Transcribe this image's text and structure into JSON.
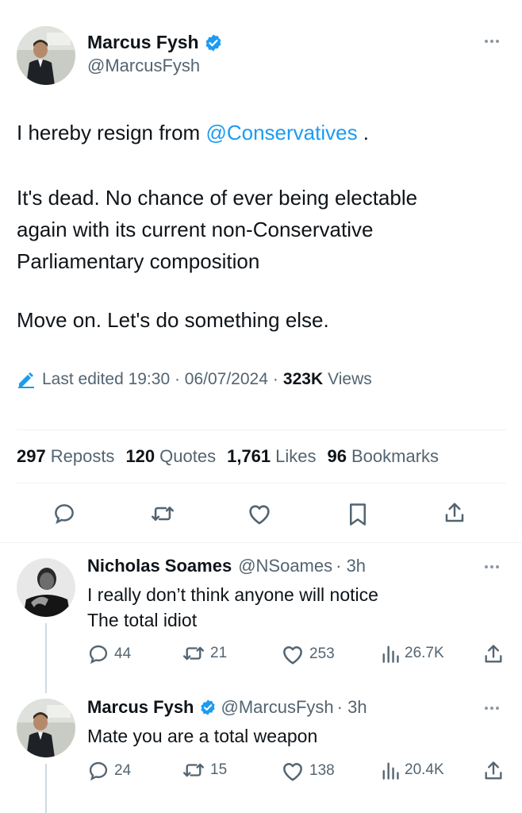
{
  "main_tweet": {
    "author_name": "Marcus Fysh",
    "handle": "@MarcusFysh",
    "text_line1_prefix": "I hereby resign from ",
    "mention": "@Conservatives",
    "text_line1_suffix": " .",
    "para2_line1": "It's dead. No chance of ever being electable",
    "para2_line2": "again with its current non-Conservative",
    "para2_line3": "Parliamentary composition",
    "para3": "Move on. Let's do something else.",
    "edited_label": "Last edited 19:30 · 06/07/2024",
    "dot": "·",
    "views_count": "323K",
    "views_label": "Views",
    "stats": {
      "reposts_count": "297",
      "reposts_label": "Reposts",
      "quotes_count": "120",
      "quotes_label": "Quotes",
      "likes_count": "1,761",
      "likes_label": "Likes",
      "bookmarks_count": "96",
      "bookmarks_label": "Bookmarks"
    }
  },
  "replies": [
    {
      "author_name": "Nicholas Soames",
      "handle": "@NSoames",
      "time": "· 3h",
      "line1": "I really don’t think anyone will notice",
      "line2": "The total idiot",
      "replies": "44",
      "reposts": "21",
      "likes": "253",
      "views": "26.7K"
    },
    {
      "author_name": "Marcus Fysh",
      "handle": "@MarcusFysh",
      "time": "· 3h",
      "line1": "Mate you are a total weapon",
      "replies": "24",
      "reposts": "15",
      "likes": "138",
      "views": "20.4K"
    }
  ],
  "colors": {
    "accent": "#1d9bf0",
    "text": "#0f1419",
    "secondary": "#536471"
  }
}
